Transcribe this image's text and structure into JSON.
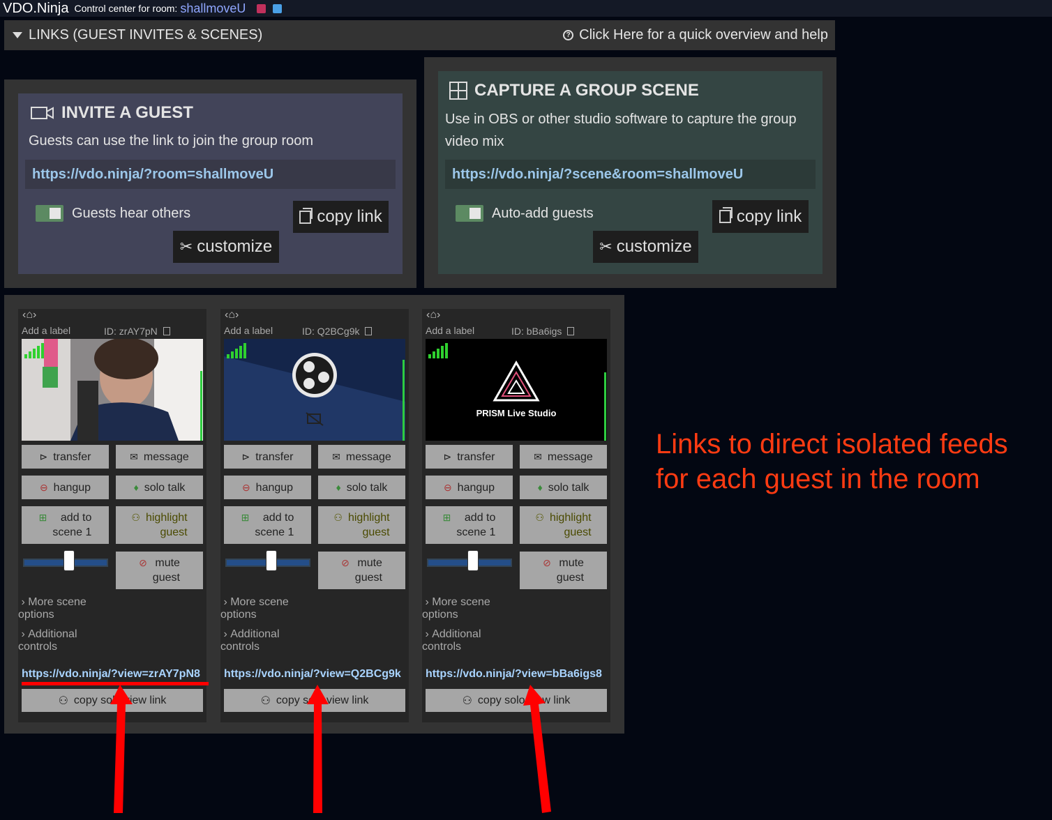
{
  "header": {
    "app_title": "VDO.Ninja",
    "control_center_label": "Control center for room:",
    "room_name": "shallmoveU"
  },
  "links_section": {
    "title": "LINKS (GUEST INVITES & SCENES)",
    "help_text": "Click Here for a quick overview and help"
  },
  "invite": {
    "title": "INVITE A GUEST",
    "description": "Guests can use the link to join the group room",
    "url": "https://vdo.ninja/?room=shallmoveU",
    "toggle_label": "Guests hear others",
    "copy_label": "copy link",
    "customize_label": "customize"
  },
  "scene": {
    "title": "CAPTURE A GROUP SCENE",
    "description": "Use in OBS or other studio software to capture the group video mix",
    "url": "https://vdo.ninja/?scene&room=shallmoveU",
    "toggle_label": "Auto-add guests",
    "copy_label": "copy link",
    "customize_label": "customize"
  },
  "guest_common": {
    "nav": "‹⌂›",
    "add_label": "Add a label",
    "transfer": "transfer",
    "message": "message",
    "hangup": "hangup",
    "solo_talk": "solo talk",
    "add_to": "add to",
    "scene_1": "scene 1",
    "highlight": "highlight",
    "guest": "guest",
    "mute": "mute",
    "more_scene": "More scene",
    "options": "options",
    "additional": "Additional",
    "controls": "controls",
    "copy_solo": "copy solo view link"
  },
  "guests": [
    {
      "id": "ID: zrAY7pN",
      "view_url": "https://vdo.ninja/?view=zrAY7pN8"
    },
    {
      "id": "ID: Q2BCg9k",
      "view_url": "https://vdo.ninja/?view=Q2BCg9k"
    },
    {
      "id": "ID: bBa6igs",
      "view_url": "https://vdo.ninja/?view=bBa6igs8",
      "prism_label": "PRISM Live Studio"
    }
  ],
  "annotation": {
    "text_line1": "Links to direct isolated feeds",
    "text_line2": "for each guest in the room",
    "color": "#ff3b12"
  }
}
